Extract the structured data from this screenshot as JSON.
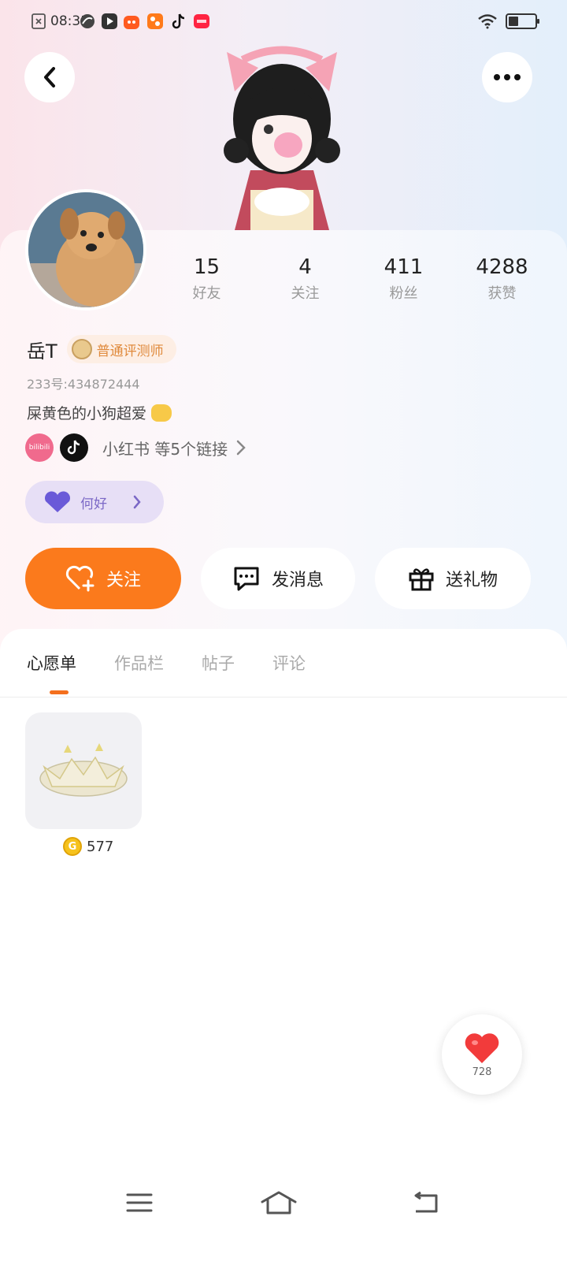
{
  "status_bar": {
    "time": "08:31",
    "app_icons": [
      {
        "name": "file-x-icon",
        "color": "#555555"
      },
      {
        "name": "app-icon",
        "color": "#444444"
      },
      {
        "name": "video-app-icon",
        "color": "#333333"
      },
      {
        "name": "taobao-icon",
        "color": "#ff5a1f"
      },
      {
        "name": "app-grid-icon",
        "color": "#ff7a1a"
      },
      {
        "name": "tiktok-icon",
        "color": "#111111"
      },
      {
        "name": "xiaohongshu-icon",
        "color": "#ff2442"
      }
    ]
  },
  "header": {
    "back_icon": "chevron-left-icon",
    "more_icon": "more-dots-icon"
  },
  "profile": {
    "stats": [
      {
        "value": "15",
        "label": "好友"
      },
      {
        "value": "4",
        "label": "关注"
      },
      {
        "value": "411",
        "label": "粉丝"
      },
      {
        "value": "4288",
        "label": "获赞"
      }
    ],
    "nickname": "岳T",
    "level_badge": "普通评测师",
    "uid": "233号:434872444",
    "bio": "屎黄色的小狗超爱",
    "social_links": {
      "bilibili_label": "bilibili",
      "text": "小红书 等5个链接"
    },
    "tag_pill": {
      "label": "何好"
    }
  },
  "actions": {
    "follow": "关注",
    "message": "发消息",
    "gift": "送礼物"
  },
  "tabs": {
    "items": [
      "心愿单",
      "作品栏",
      "帖子",
      "评论"
    ],
    "active_index": 0
  },
  "wishlist": {
    "items": [
      {
        "price": "577",
        "coin_symbol": "G"
      }
    ]
  },
  "like_button": {
    "count": "728"
  },
  "colors": {
    "accent": "#fb7a1c",
    "tag_purple": "#7b68c6",
    "level_orange": "#e08a3c"
  }
}
